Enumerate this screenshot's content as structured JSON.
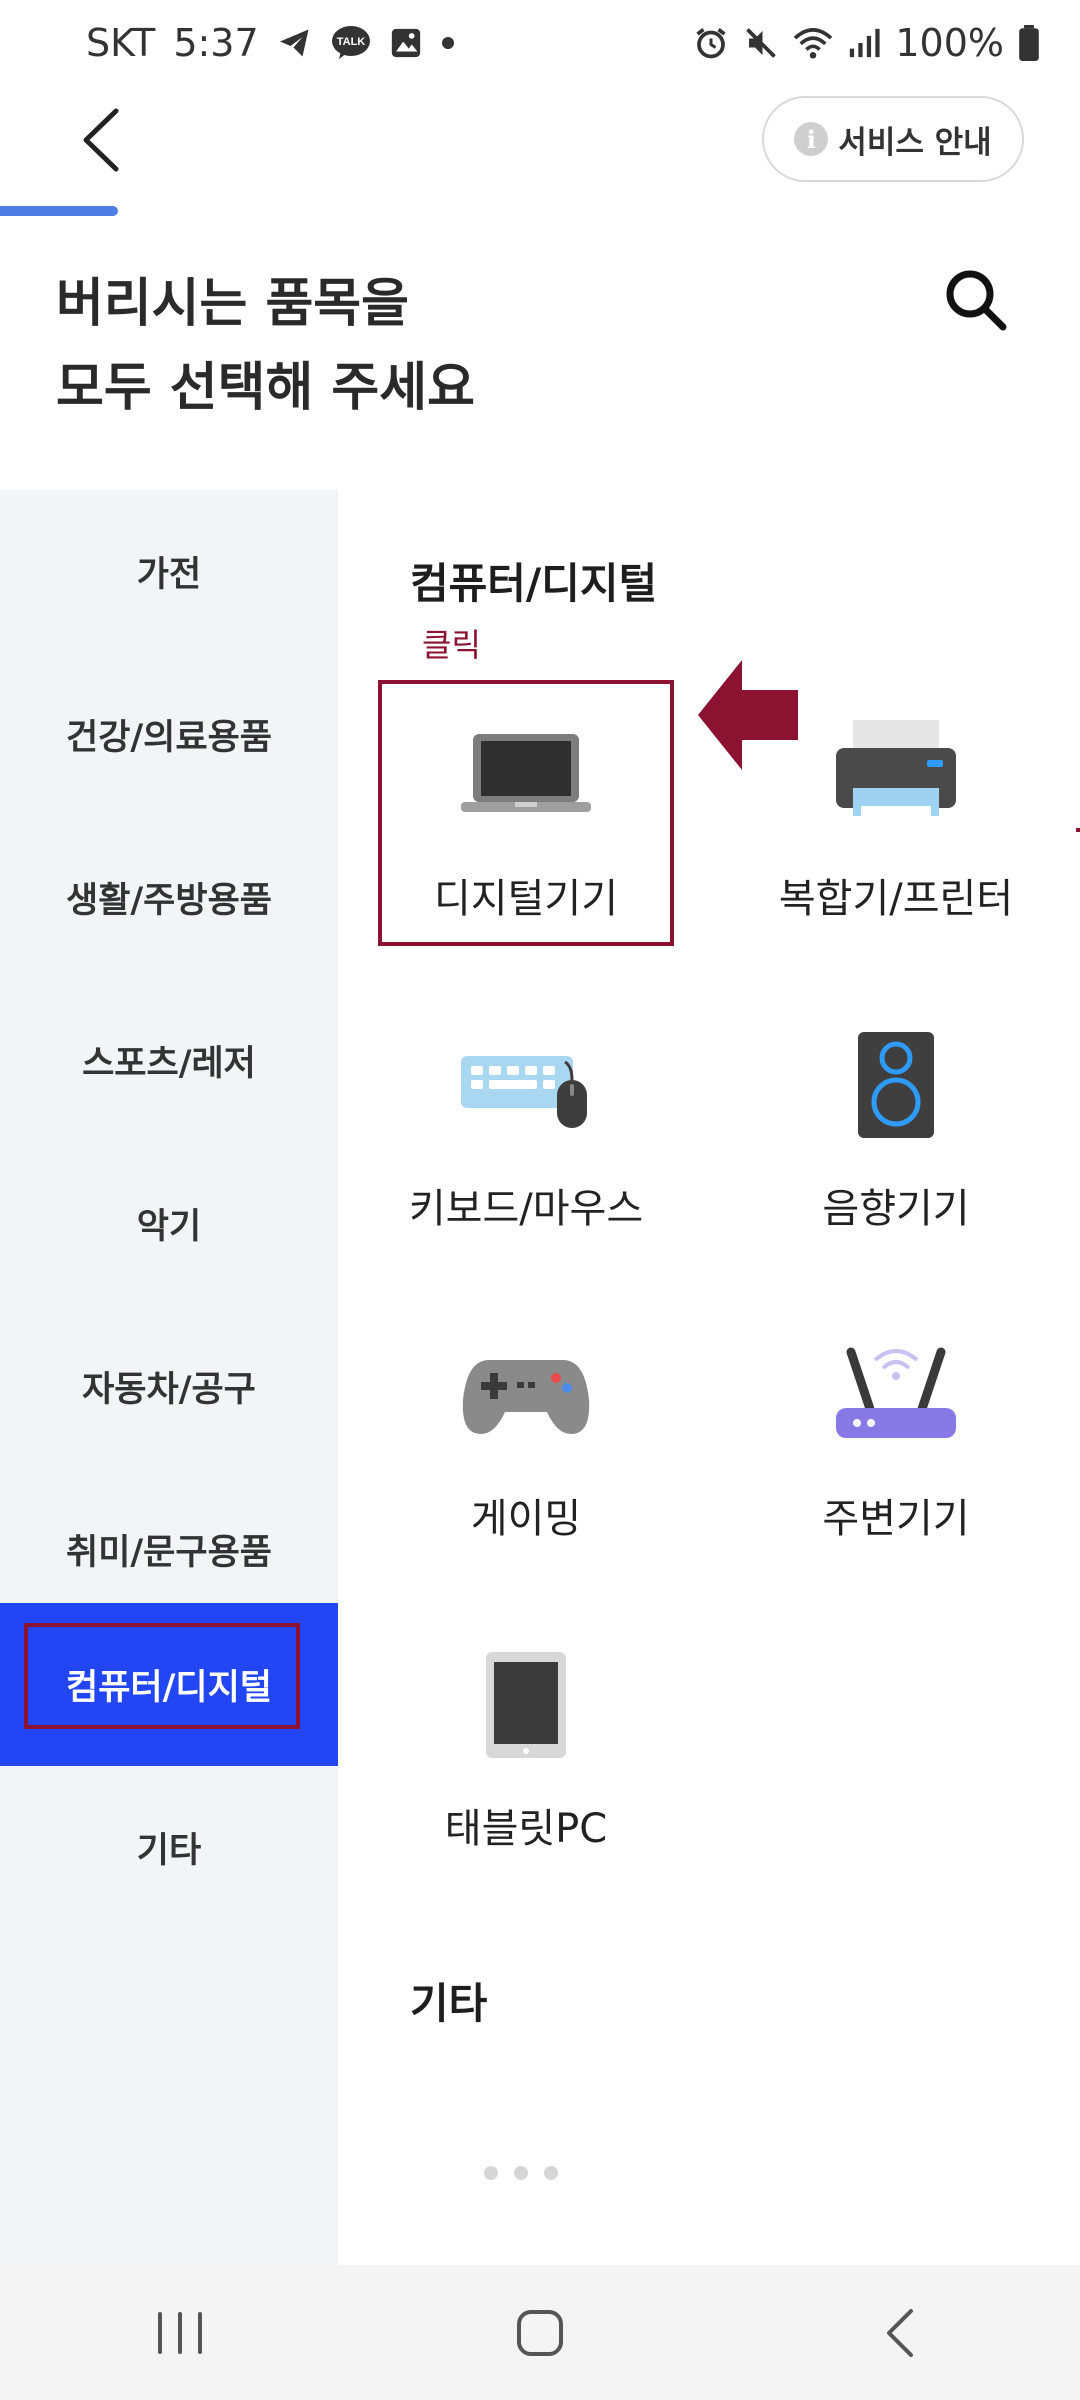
{
  "status_bar": {
    "carrier": "SKT",
    "time": "5:37",
    "left_icons": [
      "telegram-icon",
      "kakaotalk-icon",
      "gallery-icon",
      "dot-icon"
    ],
    "kakao_badge": "TALK",
    "right_icons": [
      "alarm-icon",
      "mute-icon",
      "wifi-icon",
      "signal-icon",
      "battery-icon"
    ],
    "battery": "100%"
  },
  "header": {
    "service_label": "서비스 안내",
    "info_glyph": "i",
    "progress_fraction": 0.109
  },
  "title": {
    "line1": "버리시는 품목을",
    "line2": "모두 선택해 주세요"
  },
  "sidebar": {
    "items": [
      {
        "label": "가전"
      },
      {
        "label": "건강/의료용품"
      },
      {
        "label": "생활/주방용품"
      },
      {
        "label": "스포츠/레저"
      },
      {
        "label": "악기"
      },
      {
        "label": "자동차/공구"
      },
      {
        "label": "취미/문구용품"
      },
      {
        "label": "컴퓨터/디지털"
      },
      {
        "label": "기타"
      }
    ],
    "active_index": 7
  },
  "content": {
    "section_title": "컴퓨터/디지털",
    "click_annotation": "클릭",
    "items": [
      {
        "label": "디지털기기",
        "icon": "laptop-icon"
      },
      {
        "label": "복합기/프린터",
        "icon": "printer-icon"
      },
      {
        "label": "키보드/마우스",
        "icon": "keyboard-mouse-icon"
      },
      {
        "label": "음향기기",
        "icon": "speaker-icon"
      },
      {
        "label": "게이밍",
        "icon": "gamepad-icon"
      },
      {
        "label": "주변기기",
        "icon": "router-icon"
      },
      {
        "label": "태블릿PC",
        "icon": "tablet-icon"
      }
    ],
    "next_section_title": "기타"
  },
  "colors": {
    "accent_blue": "#2346f5",
    "progress_blue": "#4f7de6",
    "annotation_red": "#8b1230",
    "sidebar_bg": "#f3f4f8"
  }
}
